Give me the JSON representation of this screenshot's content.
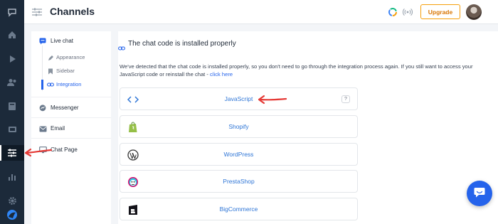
{
  "header": {
    "title": "Channels",
    "upgrade_label": "Upgrade"
  },
  "rail": {
    "icons": [
      "channels-logo-icon",
      "home-icon",
      "play-icon",
      "users-icon",
      "book-icon",
      "inbox-icon",
      "sliders-icon",
      "chart-icon",
      "gear-icon",
      "brand-logo-icon"
    ],
    "active": "sliders-icon"
  },
  "submenu": {
    "live_chat": "Live chat",
    "appearance": "Appearance",
    "sidebar": "Sidebar",
    "integration": "Integration",
    "messenger": "Messenger",
    "email": "Email",
    "chat_page": "Chat Page"
  },
  "main": {
    "heading": "The chat code is installed properly",
    "description": "We've detected that the chat code is installed properly, so you don't need to go through the integration process again. If you still want to access your JavaScript code or reinstall the chat - ",
    "click_here": "click here",
    "help_symbol": "?",
    "platforms": [
      {
        "label": "JavaScript",
        "icon": "code-brackets-icon"
      },
      {
        "label": "Shopify",
        "icon": "shopify-bag-icon"
      },
      {
        "label": "WordPress",
        "icon": "wordpress-icon"
      },
      {
        "label": "PrestaShop",
        "icon": "prestashop-icon"
      },
      {
        "label": "BigCommerce",
        "icon": "bigcommerce-icon"
      }
    ]
  },
  "colors": {
    "rail": "#1c2a3a",
    "accent": "#2563eb",
    "link": "#2e75d6",
    "upgrade": "#f59e0b",
    "annotation_arrow": "#e53935"
  }
}
